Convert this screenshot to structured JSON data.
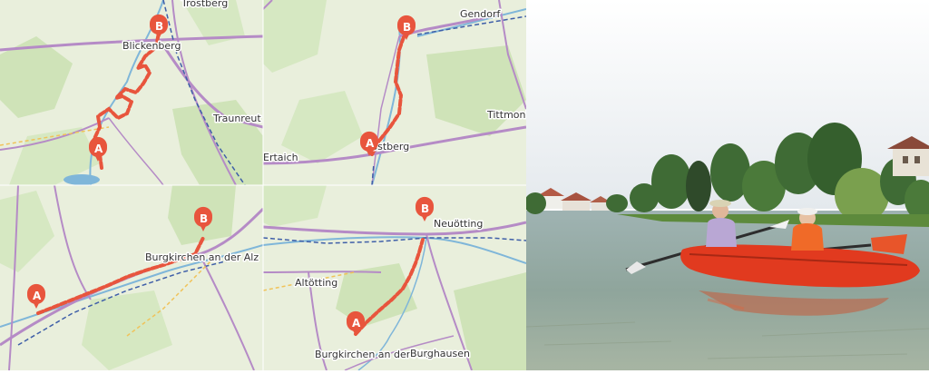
{
  "panels": [
    {
      "id": "panel-1",
      "labels": [
        "Trostberg",
        "Blickenberg",
        "Traunreut"
      ],
      "markers": [
        "A",
        "B"
      ]
    },
    {
      "id": "panel-2",
      "labels": [
        "Gendorf",
        "Tittmoning",
        "Ertaich",
        "Trostberg"
      ],
      "markers": [
        "A",
        "B"
      ]
    },
    {
      "id": "panel-3",
      "labels": [
        "Burgkirchen an der Alz"
      ],
      "markers": [
        "A",
        "B"
      ]
    },
    {
      "id": "panel-4",
      "labels": [
        "Altötting",
        "Burgkirchen an der Alz",
        "Burghausen",
        "Neuötting"
      ],
      "markers": [
        "A",
        "B"
      ]
    }
  ],
  "colors": {
    "route": "#e8553d",
    "marker": "#e8553d",
    "map_bg": "#e9efdc",
    "forest": "#c9e0b0",
    "road": "#b58bc6",
    "river": "#7fb6d9",
    "rail": "#3f5fa8"
  },
  "photo": {
    "subject": "two people paddling a red kayak on a river"
  }
}
